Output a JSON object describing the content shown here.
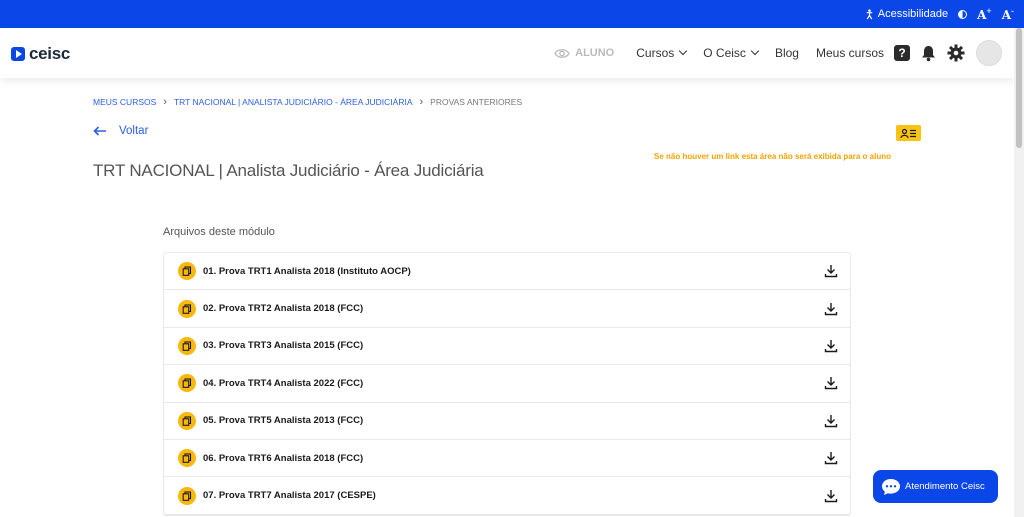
{
  "accessibility_bar": {
    "label": "Acessibilidade",
    "font_increase": "A",
    "font_increase_suffix": "+",
    "font_decrease": "A",
    "font_decrease_suffix": "-"
  },
  "header": {
    "logo_text": "ceisc",
    "view_mode": "ALUNO",
    "nav": {
      "cursos": "Cursos",
      "o_ceisc": "O Ceisc",
      "blog": "Blog",
      "meus_cursos": "Meus cursos"
    },
    "help_icon": "?"
  },
  "breadcrumb": {
    "items": [
      "MEUS CURSOS",
      "TRT NACIONAL | ANALISTA JUDICIÁRIO - ÁREA JUDICIÁRIA"
    ],
    "current": "PROVAS ANTERIORES"
  },
  "back_label": "Voltar",
  "page_title": "TRT NACIONAL | Analista Judiciário - Área Judiciária",
  "notice": "Se não houver um link esta área não será exibida para o aluno",
  "files_section_label": "Arquivos deste módulo",
  "files": [
    "01. Prova TRT1 Analista 2018 (Instituto AOCP)",
    "02. Prova TRT2 Analista 2018 (FCC)",
    "03. Prova TRT3 Analista 2015 (FCC)",
    "04. Prova TRT4 Analista 2022 (FCC)",
    "05. Prova TRT5 Analista 2013 (FCC)",
    "06. Prova TRT6 Analista 2018 (FCC)",
    "07. Prova TRT7 Analista 2017 (CESPE)"
  ],
  "chat_button": "Atendimento Ceisc",
  "colors": {
    "brand_blue": "#0b47e8",
    "link_blue": "#2b5ee3",
    "accent_yellow": "#f9b80f",
    "notice_orange": "#f5a300"
  }
}
